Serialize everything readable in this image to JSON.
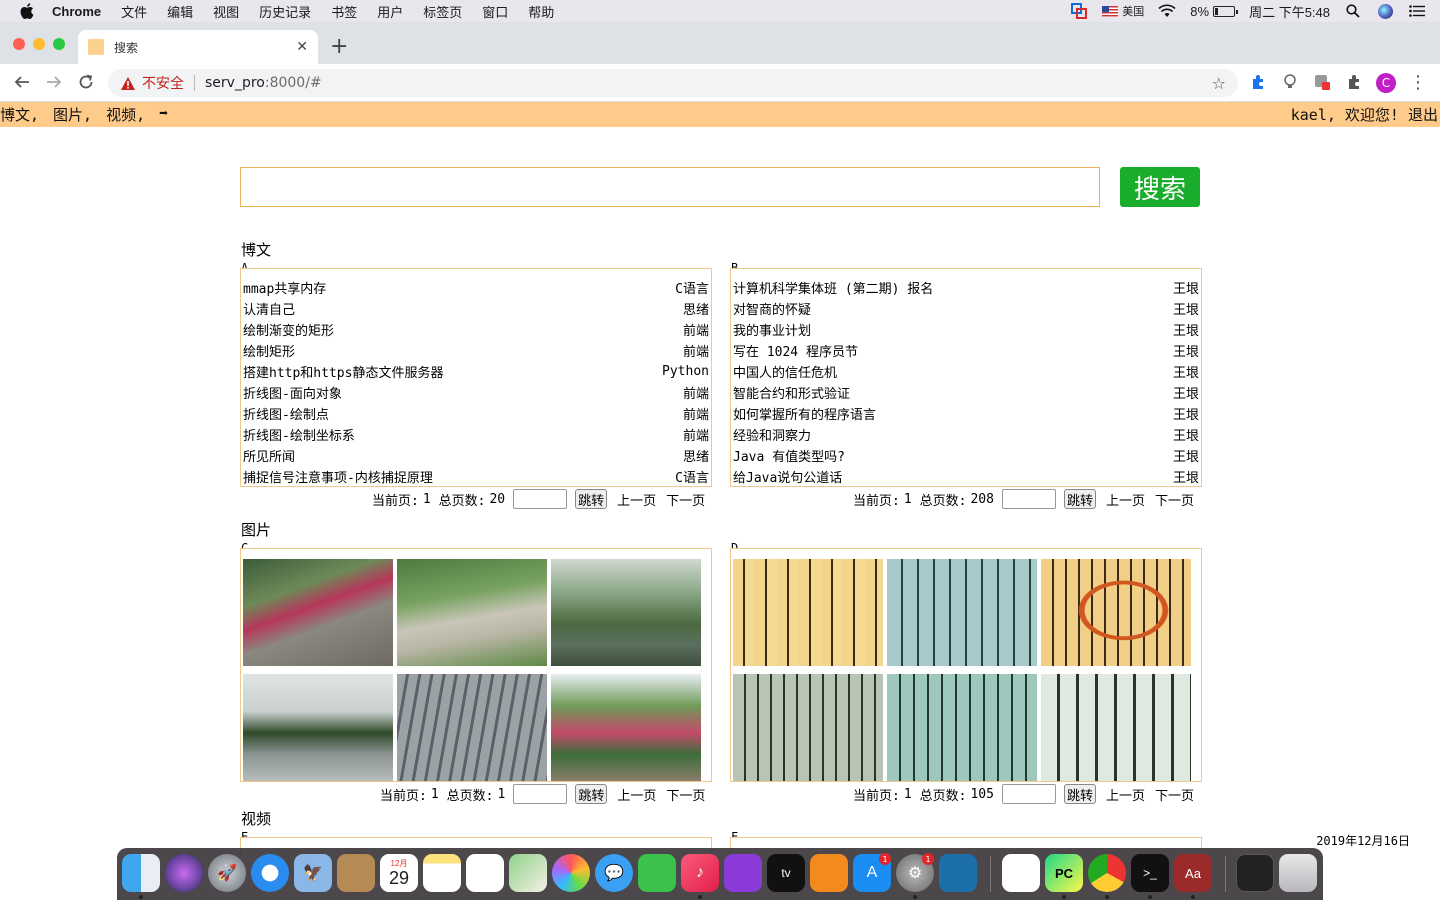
{
  "menubar": {
    "app": "Chrome",
    "items": [
      "文件",
      "编辑",
      "视图",
      "历史记录",
      "书签",
      "用户",
      "标签页",
      "窗口",
      "帮助"
    ],
    "input_source": "美国",
    "battery": "8%",
    "clock": "周二 下午5:48"
  },
  "browser": {
    "tab_title": "搜索",
    "security_label": "不安全",
    "url_host": "serv_pro",
    "url_rest": ":8000/#"
  },
  "page": {
    "nav_links": [
      "博文,",
      "图片,",
      "视频,",
      "➡"
    ],
    "user_greeting": "kael, 欢迎您! 退出",
    "search_button": "搜索",
    "date": "2019年12月16日",
    "sections": {
      "blog_title": "博文",
      "image_title": "图片",
      "video_title": "视频"
    },
    "pager_labels": {
      "current": "当前页:",
      "total": "总页数:",
      "jump": "跳转",
      "prev": "上一页",
      "next": "下一页"
    },
    "panel_a": {
      "label": "A",
      "rows": [
        {
          "title": "mmap共享内存",
          "tag": "C语言"
        },
        {
          "title": "认清自己",
          "tag": "思绪"
        },
        {
          "title": "绘制渐变的矩形",
          "tag": "前端"
        },
        {
          "title": "绘制矩形",
          "tag": "前端"
        },
        {
          "title": "搭建http和https静态文件服务器",
          "tag": "Python"
        },
        {
          "title": "折线图-面向对象",
          "tag": "前端"
        },
        {
          "title": "折线图-绘制点",
          "tag": "前端"
        },
        {
          "title": "折线图-绘制坐标系",
          "tag": "前端"
        },
        {
          "title": "所见所闻",
          "tag": "思绪"
        },
        {
          "title": "捕捉信号注意事项-内核捕捉原理",
          "tag": "C语言"
        }
      ],
      "current_page": "1",
      "total_pages": "20"
    },
    "panel_b": {
      "label": "B",
      "rows": [
        {
          "title": "计算机科学集体班 (第二期) 报名",
          "tag": "王垠"
        },
        {
          "title": "对智商的怀疑",
          "tag": "王垠"
        },
        {
          "title": "我的事业计划",
          "tag": "王垠"
        },
        {
          "title": "写在 1024 程序员节",
          "tag": "王垠"
        },
        {
          "title": "中国人的信任危机",
          "tag": "王垠"
        },
        {
          "title": "智能合约和形式验证",
          "tag": "王垠"
        },
        {
          "title": "如何掌握所有的程序语言",
          "tag": "王垠"
        },
        {
          "title": "经验和洞察力",
          "tag": "王垠"
        },
        {
          "title": "Java 有值类型吗?",
          "tag": "王垠"
        },
        {
          "title": "给Java说句公道话",
          "tag": "王垠"
        }
      ],
      "current_page": "1",
      "total_pages": "208"
    },
    "panel_c": {
      "label": "C",
      "current_page": "1",
      "total_pages": "1"
    },
    "panel_d": {
      "label": "D",
      "current_page": "1",
      "total_pages": "105"
    },
    "panel_e": {
      "label": "E"
    },
    "panel_f": {
      "label": "F"
    }
  },
  "dock": {
    "calendar_month": "12月",
    "calendar_day": "29",
    "appstore_badge": "1",
    "settings_badge": "1"
  }
}
